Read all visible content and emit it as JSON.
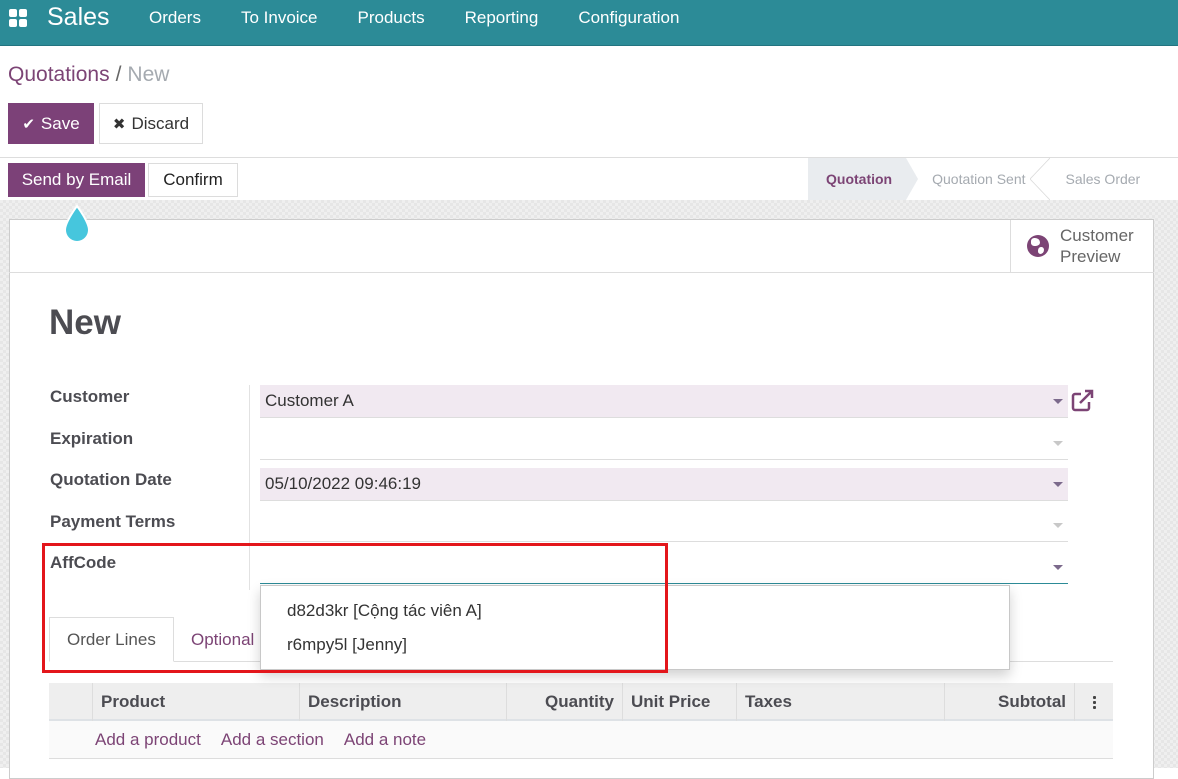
{
  "navbar": {
    "app_name": "Sales",
    "menu": [
      "Orders",
      "To Invoice",
      "Products",
      "Reporting",
      "Configuration"
    ]
  },
  "breadcrumb": {
    "parent": "Quotations",
    "separator": "/",
    "current": "New"
  },
  "toolbar": {
    "save_label": "Save",
    "discard_label": "Discard"
  },
  "statusbar": {
    "send_email_label": "Send by Email",
    "confirm_label": "Confirm",
    "stages": [
      {
        "label": "Quotation",
        "active": true
      },
      {
        "label": "Quotation Sent",
        "active": false
      },
      {
        "label": "Sales Order",
        "active": false
      }
    ]
  },
  "button_box": {
    "customer_preview_line1": "Customer",
    "customer_preview_line2": "Preview"
  },
  "record": {
    "title": "New"
  },
  "fields": {
    "customer": {
      "label": "Customer",
      "value": "Customer A"
    },
    "expiration": {
      "label": "Expiration",
      "value": ""
    },
    "quotation_date": {
      "label": "Quotation Date",
      "value": "05/10/2022 09:46:19"
    },
    "payment_terms": {
      "label": "Payment Terms",
      "value": ""
    },
    "affcode": {
      "label": "AffCode",
      "value": ""
    }
  },
  "affcode_dropdown": {
    "options": [
      "d82d3kr [Cộng tác viên A]",
      "r6mpy5l [Jenny]"
    ]
  },
  "tabs": [
    "Order Lines",
    "Optional"
  ],
  "order_lines": {
    "columns": [
      "Product",
      "Description",
      "Quantity",
      "Unit Price",
      "Taxes",
      "Subtotal"
    ],
    "add_links": [
      "Add a product",
      "Add a section",
      "Add a note"
    ]
  },
  "colors": {
    "navbar": "#2c8b97",
    "primary": "#7c4178",
    "highlight_box": "#e3161b",
    "required_field": "#f1e9f1"
  }
}
